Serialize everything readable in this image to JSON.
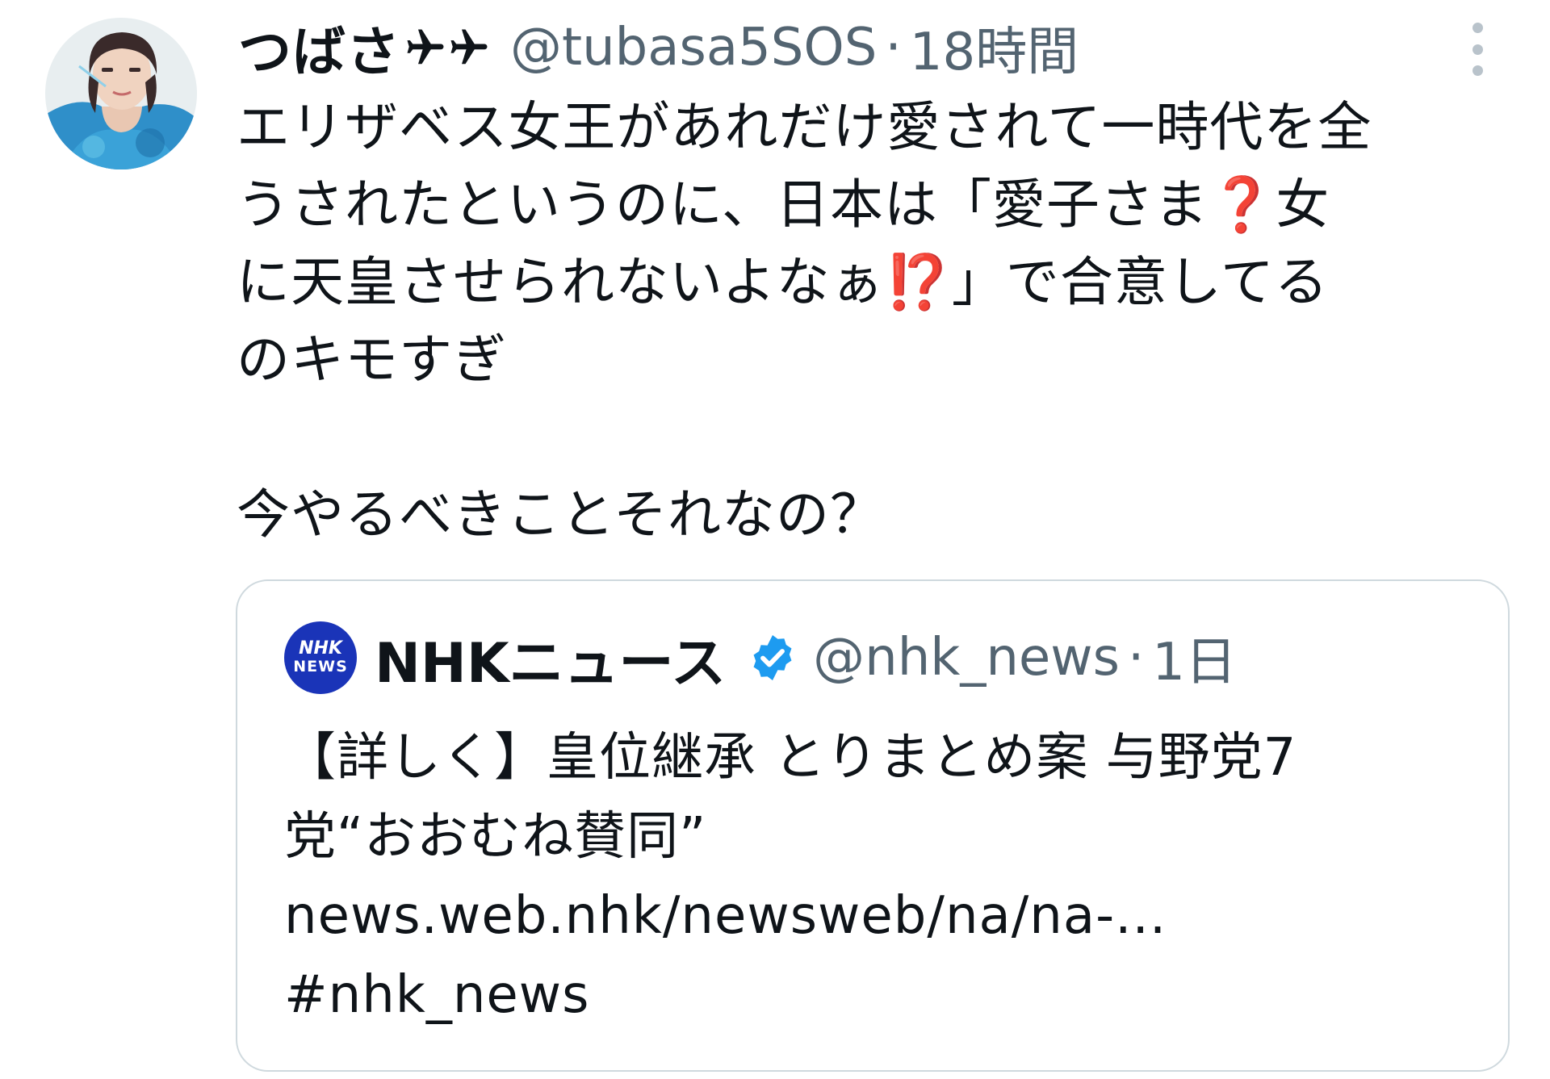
{
  "tweet": {
    "author": {
      "display_name": "つばさ",
      "display_name_emoji": "airplane-icon x2",
      "handle": "@tubasa5SOS",
      "separator": "·",
      "time": "18時間",
      "avatar_icon": "user-avatar"
    },
    "more_icon": "more-vertical-icon",
    "body": {
      "line1": "エリザベス女王があれだけ愛されて一時代を全",
      "line2a": "うされたというのに、日本は「愛子さま",
      "line2_emoji": "❓",
      "line2b": "女",
      "line3a": "に天皇させられないよなぁ",
      "line3_emoji": "⁉️",
      "line3b": "」で合意してる",
      "line4": "のキモすぎ",
      "line5": "",
      "line6": "今やるべきことそれなの？"
    },
    "quote": {
      "logo_line1": "NHK",
      "logo_line2": "NEWS",
      "display_name": "NHKニュース",
      "verified_icon": "verified-badge-icon",
      "handle": "@nhk_news",
      "separator": "·",
      "time": "1日",
      "text_line1": "【詳しく】皇位継承 とりまとめ案 与野党7",
      "text_line2": "党“おおむね賛同”",
      "text_line3": "news.web.nhk/newsweb/na/na-...",
      "text_line4": "#nhk_news"
    }
  },
  "colors": {
    "text_primary": "#0f1419",
    "text_secondary": "#536471",
    "border": "#cfd9de",
    "verified": "#1d9bf0",
    "nhk_logo_bg": "#1a34b8",
    "emoji_red": "#e0302a"
  }
}
